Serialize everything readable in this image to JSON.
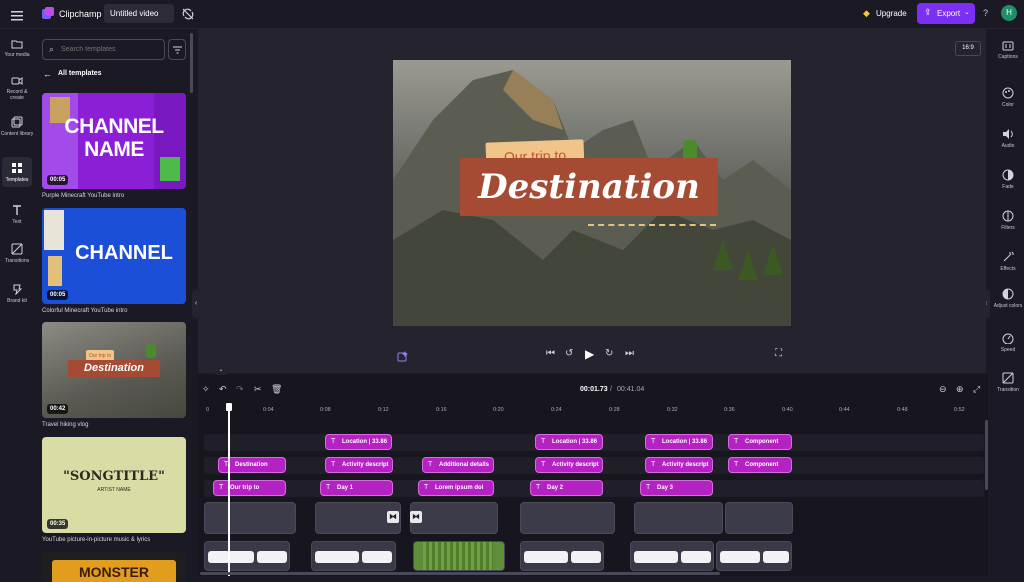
{
  "app": {
    "name": "Clipchamp",
    "project_title": "Untitled video"
  },
  "header": {
    "upgrade_label": "Upgrade",
    "export_label": "Export",
    "help_label": "?",
    "avatar_initial": "H"
  },
  "left_rail": [
    {
      "label": "Your media",
      "icon": "folder-icon"
    },
    {
      "label": "Record & create",
      "icon": "camera-icon"
    },
    {
      "label": "Content library",
      "icon": "library-icon"
    },
    {
      "label": "Templates",
      "icon": "templates-icon",
      "active": true
    },
    {
      "label": "Text",
      "icon": "text-icon"
    },
    {
      "label": "Transitions",
      "icon": "transitions-icon"
    },
    {
      "label": "Brand kit",
      "icon": "brand-kit-icon"
    }
  ],
  "templates_panel": {
    "search_placeholder": "Search templates",
    "back_label": "All templates",
    "items": [
      {
        "title": "Purple Minecraft YouTube intro",
        "duration": "00:05",
        "thumb_text": [
          "CHANNEL",
          "NAME"
        ],
        "bg": "#8a1fd6"
      },
      {
        "title": "Colorful Minecraft YouTube intro",
        "duration": "00:05",
        "thumb_text": [
          "CHANNEL"
        ],
        "bg": "#1c4fd8"
      },
      {
        "title": "Travel hiking vlog",
        "duration": "00:42",
        "thumb_text": [
          "Our trip to",
          "Destination"
        ],
        "bg": "#6b6960"
      },
      {
        "title": "YouTube picture-in-picture music & lyrics",
        "duration": "00:35",
        "thumb_text": [
          "\"SONGTITLE\"",
          "ARTIST NAME"
        ],
        "bg": "#d9dca4"
      },
      {
        "title": "",
        "duration": "",
        "thumb_text": [
          "MONSTER"
        ],
        "bg": "#e39d1c"
      }
    ]
  },
  "preview": {
    "aspect_ratio": "16:9",
    "subtitle": "Our trip to",
    "title": "Destination"
  },
  "right_rail": [
    {
      "label": "Captions",
      "icon": "captions-icon"
    },
    {
      "label": "Color",
      "icon": "color-icon"
    },
    {
      "label": "Audio",
      "icon": "audio-icon"
    },
    {
      "label": "Fade",
      "icon": "fade-icon"
    },
    {
      "label": "Filters",
      "icon": "filters-icon"
    },
    {
      "label": "Effects",
      "icon": "effects-icon"
    },
    {
      "label": "Adjust colors",
      "icon": "adjust-colors-icon"
    },
    {
      "label": "Speed",
      "icon": "speed-icon"
    },
    {
      "label": "Transition",
      "icon": "transition-icon"
    }
  ],
  "timeline": {
    "current_time": "00:01.73",
    "total_time": "00:41.04",
    "ruler": [
      "0",
      "0:04",
      "0:08",
      "0:12",
      "0:16",
      "0:20",
      "0:24",
      "0:28",
      "0:32",
      "0:36",
      "0:40",
      "0:44",
      "0:48",
      "0:52"
    ],
    "text_row1": [
      "Location | 33.86",
      "Location | 33.86",
      "Location | 33.86",
      "Component"
    ],
    "text_row2": [
      "Destination",
      "Activity descript",
      "Additional details",
      "Activity descript",
      "Activity descript",
      "Component"
    ],
    "text_row3": [
      "Our trip to",
      "Day 1",
      "Lorem ipsum dol",
      "Day 2",
      "Day 3"
    ]
  },
  "colors": {
    "accent": "#7b2ff2",
    "clip": "#b522c2",
    "background": "#1b1a24"
  }
}
